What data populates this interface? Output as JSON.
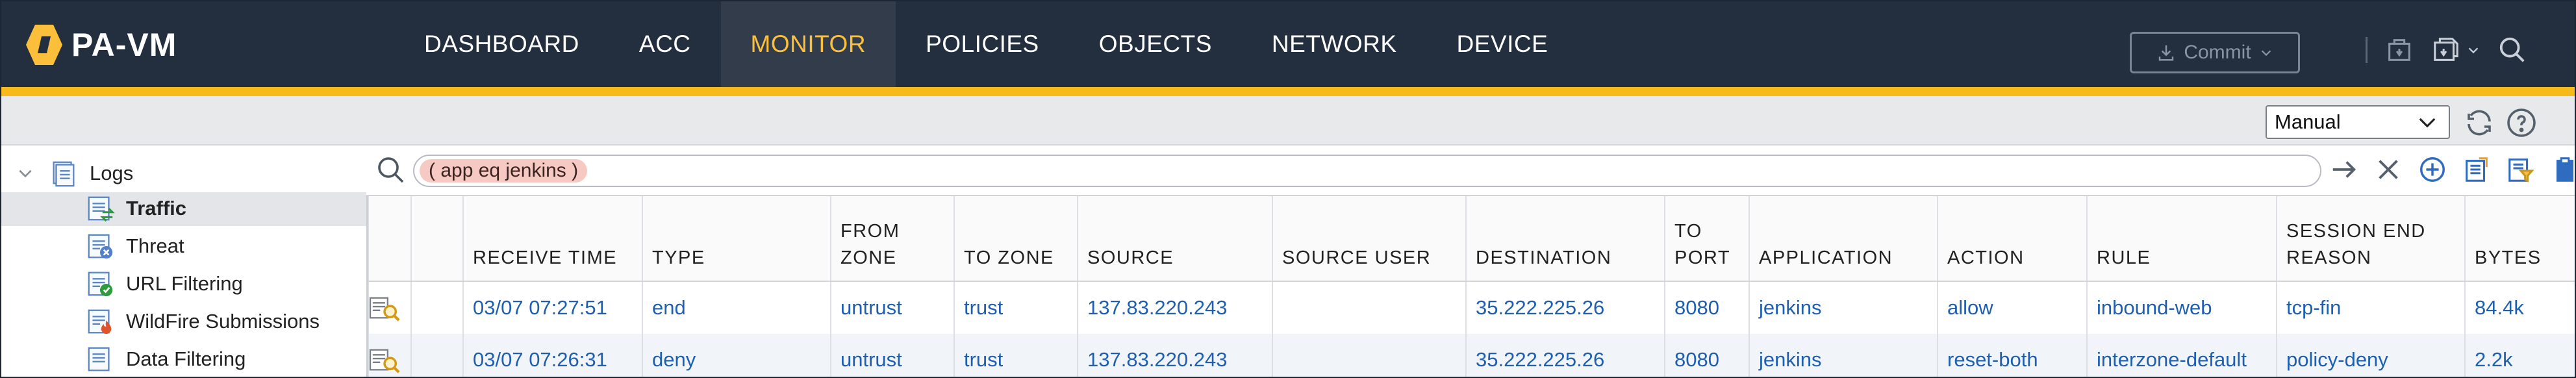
{
  "app": {
    "name": "PA-VM"
  },
  "nav": {
    "tabs": [
      "DASHBOARD",
      "ACC",
      "MONITOR",
      "POLICIES",
      "OBJECTS",
      "NETWORK",
      "DEVICE"
    ],
    "active": "MONITOR"
  },
  "header": {
    "commit_label": "Commit"
  },
  "toolbar": {
    "refresh_mode": "Manual"
  },
  "tree": {
    "root": "Logs",
    "items": [
      "Traffic",
      "Threat",
      "URL Filtering",
      "WildFire Submissions",
      "Data Filtering"
    ],
    "selected": "Traffic"
  },
  "search": {
    "filter_text": "( app eq jenkins )"
  },
  "table": {
    "columns": [
      "RECEIVE TIME",
      "TYPE",
      "FROM ZONE",
      "TO ZONE",
      "SOURCE",
      "SOURCE USER",
      "DESTINATION",
      "TO PORT",
      "APPLICATION",
      "ACTION",
      "RULE",
      "SESSION END REASON",
      "BYTES"
    ],
    "rows": [
      [
        "03/07 07:27:51",
        "end",
        "untrust",
        "trust",
        "137.83.220.243",
        "",
        "35.222.225.26",
        "8080",
        "jenkins",
        "allow",
        "inbound-web",
        "tcp-fin",
        "84.4k"
      ],
      [
        "03/07 07:26:31",
        "deny",
        "untrust",
        "trust",
        "137.83.220.243",
        "",
        "35.222.225.26",
        "8080",
        "jenkins",
        "reset-both",
        "interzone-default",
        "policy-deny",
        "2.2k"
      ]
    ]
  },
  "colors": {
    "topbar": "#232f3e",
    "accent": "#fbbf3c",
    "link": "#1f5fb0",
    "filter_pill": "#f6c9c3"
  }
}
